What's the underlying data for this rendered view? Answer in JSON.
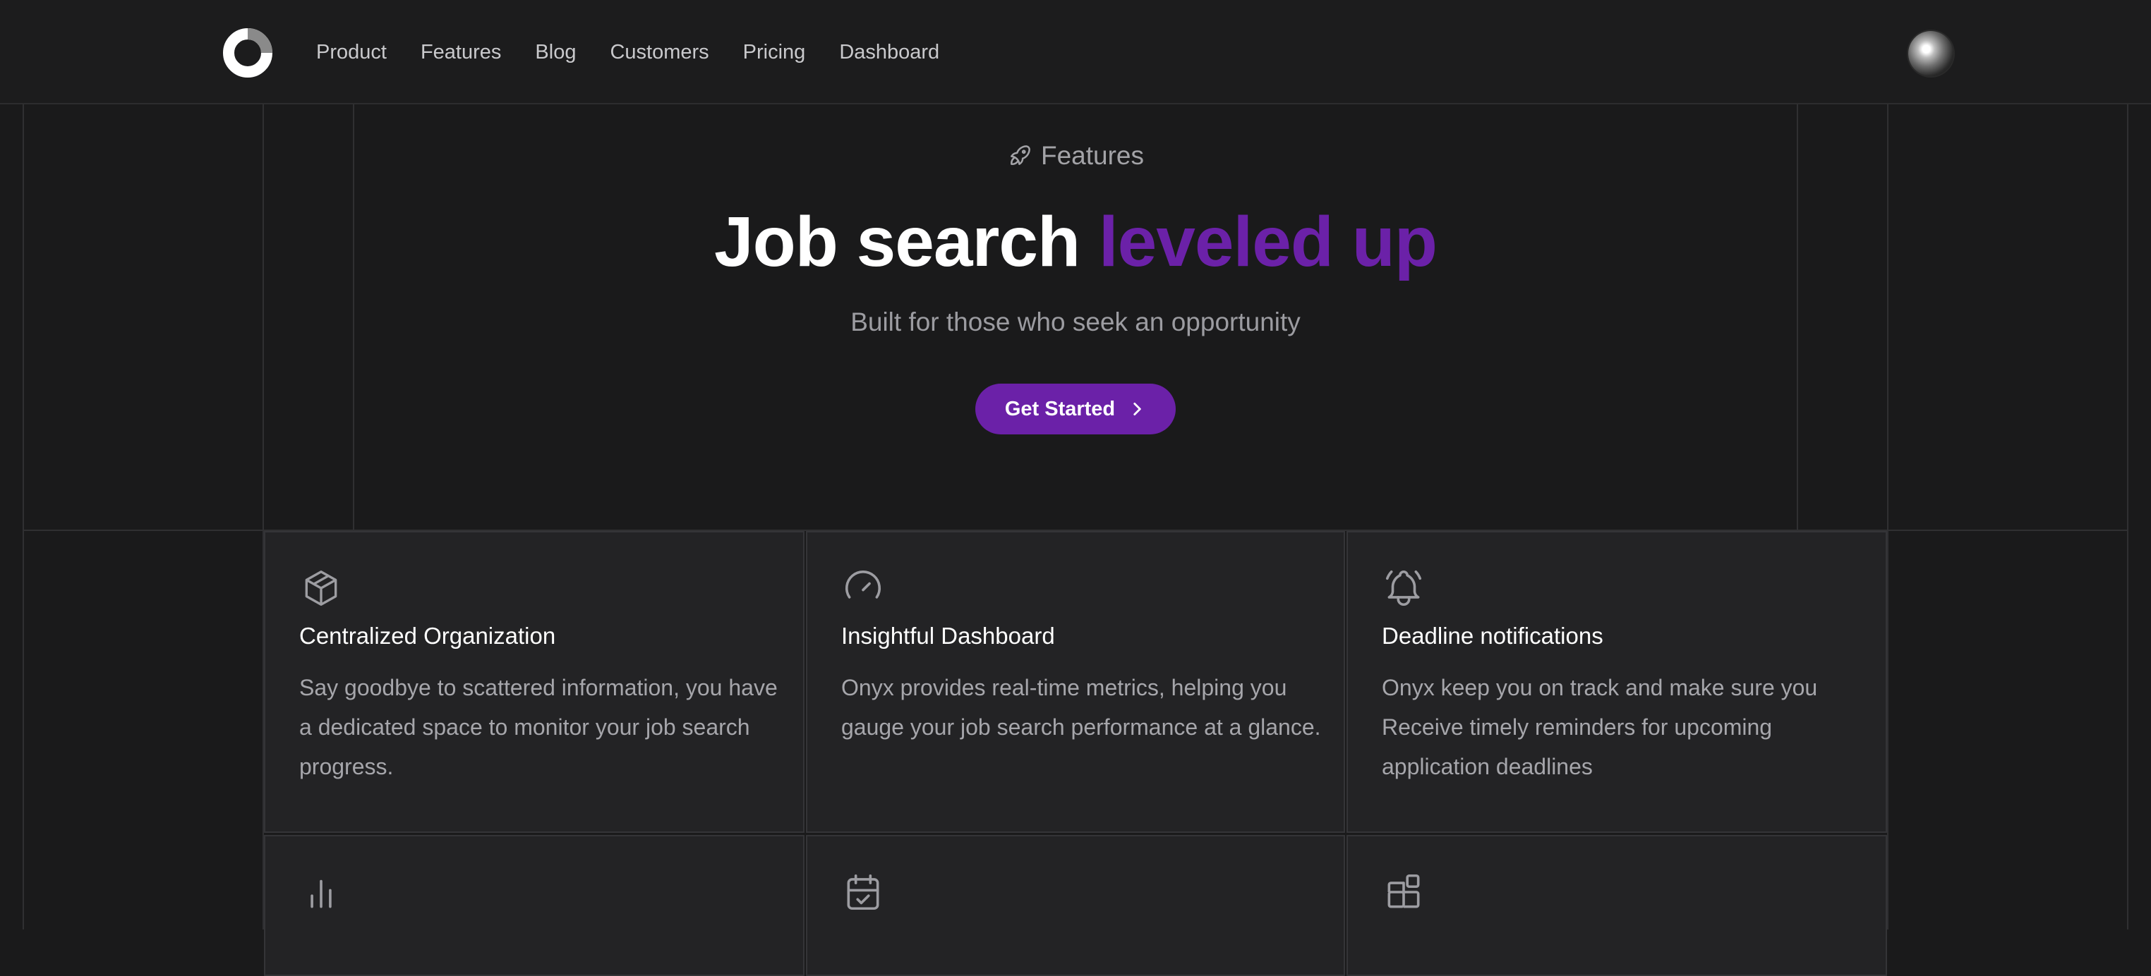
{
  "nav": {
    "items": [
      "Product",
      "Features",
      "Blog",
      "Customers",
      "Pricing",
      "Dashboard"
    ]
  },
  "hero": {
    "eyebrow": "Features",
    "title_main": "Job search",
    "title_accent": "leveled up",
    "subtitle": "Built for those who seek an opportunity",
    "cta_label": "Get Started"
  },
  "features": [
    {
      "icon": "box-icon",
      "title": "Centralized Organization",
      "description": "Say goodbye to scattered information, you have a dedicated space to monitor your job search progress."
    },
    {
      "icon": "gauge-icon",
      "title": "Insightful Dashboard",
      "description": "Onyx provides real-time metrics, helping you gauge your job search performance at a glance."
    },
    {
      "icon": "bell-ringing-icon",
      "title": "Deadline notifications",
      "description": "Onyx keep you on track and make sure you Receive timely reminders for upcoming application deadlines"
    },
    {
      "icon": "bar-chart-icon",
      "title": "",
      "description": ""
    },
    {
      "icon": "calendar-check-icon",
      "title": "",
      "description": ""
    },
    {
      "icon": "apps-add-icon",
      "title": "",
      "description": ""
    }
  ],
  "colors": {
    "background": "#1a1a1b",
    "accent": "#6b21a8",
    "card": "#232325"
  }
}
